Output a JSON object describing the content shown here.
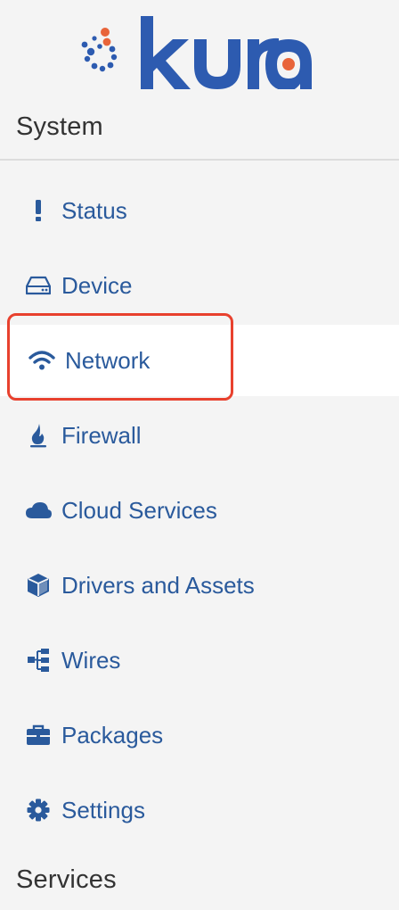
{
  "brand": {
    "logo_text": "kura",
    "colors": {
      "primary": "#2a5a9c",
      "dots_blue": "#2d5bb0",
      "dots_orange": "#e8643a"
    }
  },
  "sections": {
    "system_title": "System",
    "services_title": "Services"
  },
  "nav": {
    "items": [
      {
        "label": "Status",
        "icon": "exclamation-icon"
      },
      {
        "label": "Device",
        "icon": "hard-drive-icon"
      },
      {
        "label": "Network",
        "icon": "wifi-icon",
        "active": true
      },
      {
        "label": "Firewall",
        "icon": "fire-icon"
      },
      {
        "label": "Cloud Services",
        "icon": "cloud-icon"
      },
      {
        "label": "Drivers and Assets",
        "icon": "cube-icon"
      },
      {
        "label": "Wires",
        "icon": "sitemap-icon"
      },
      {
        "label": "Packages",
        "icon": "briefcase-icon"
      },
      {
        "label": "Settings",
        "icon": "gear-icon"
      }
    ]
  },
  "colors": {
    "sidebar_bg": "#f4f4f4",
    "active_bg": "#ffffff",
    "link": "#2a5a9c",
    "header_text": "#333333",
    "highlight": "#e8412e"
  }
}
